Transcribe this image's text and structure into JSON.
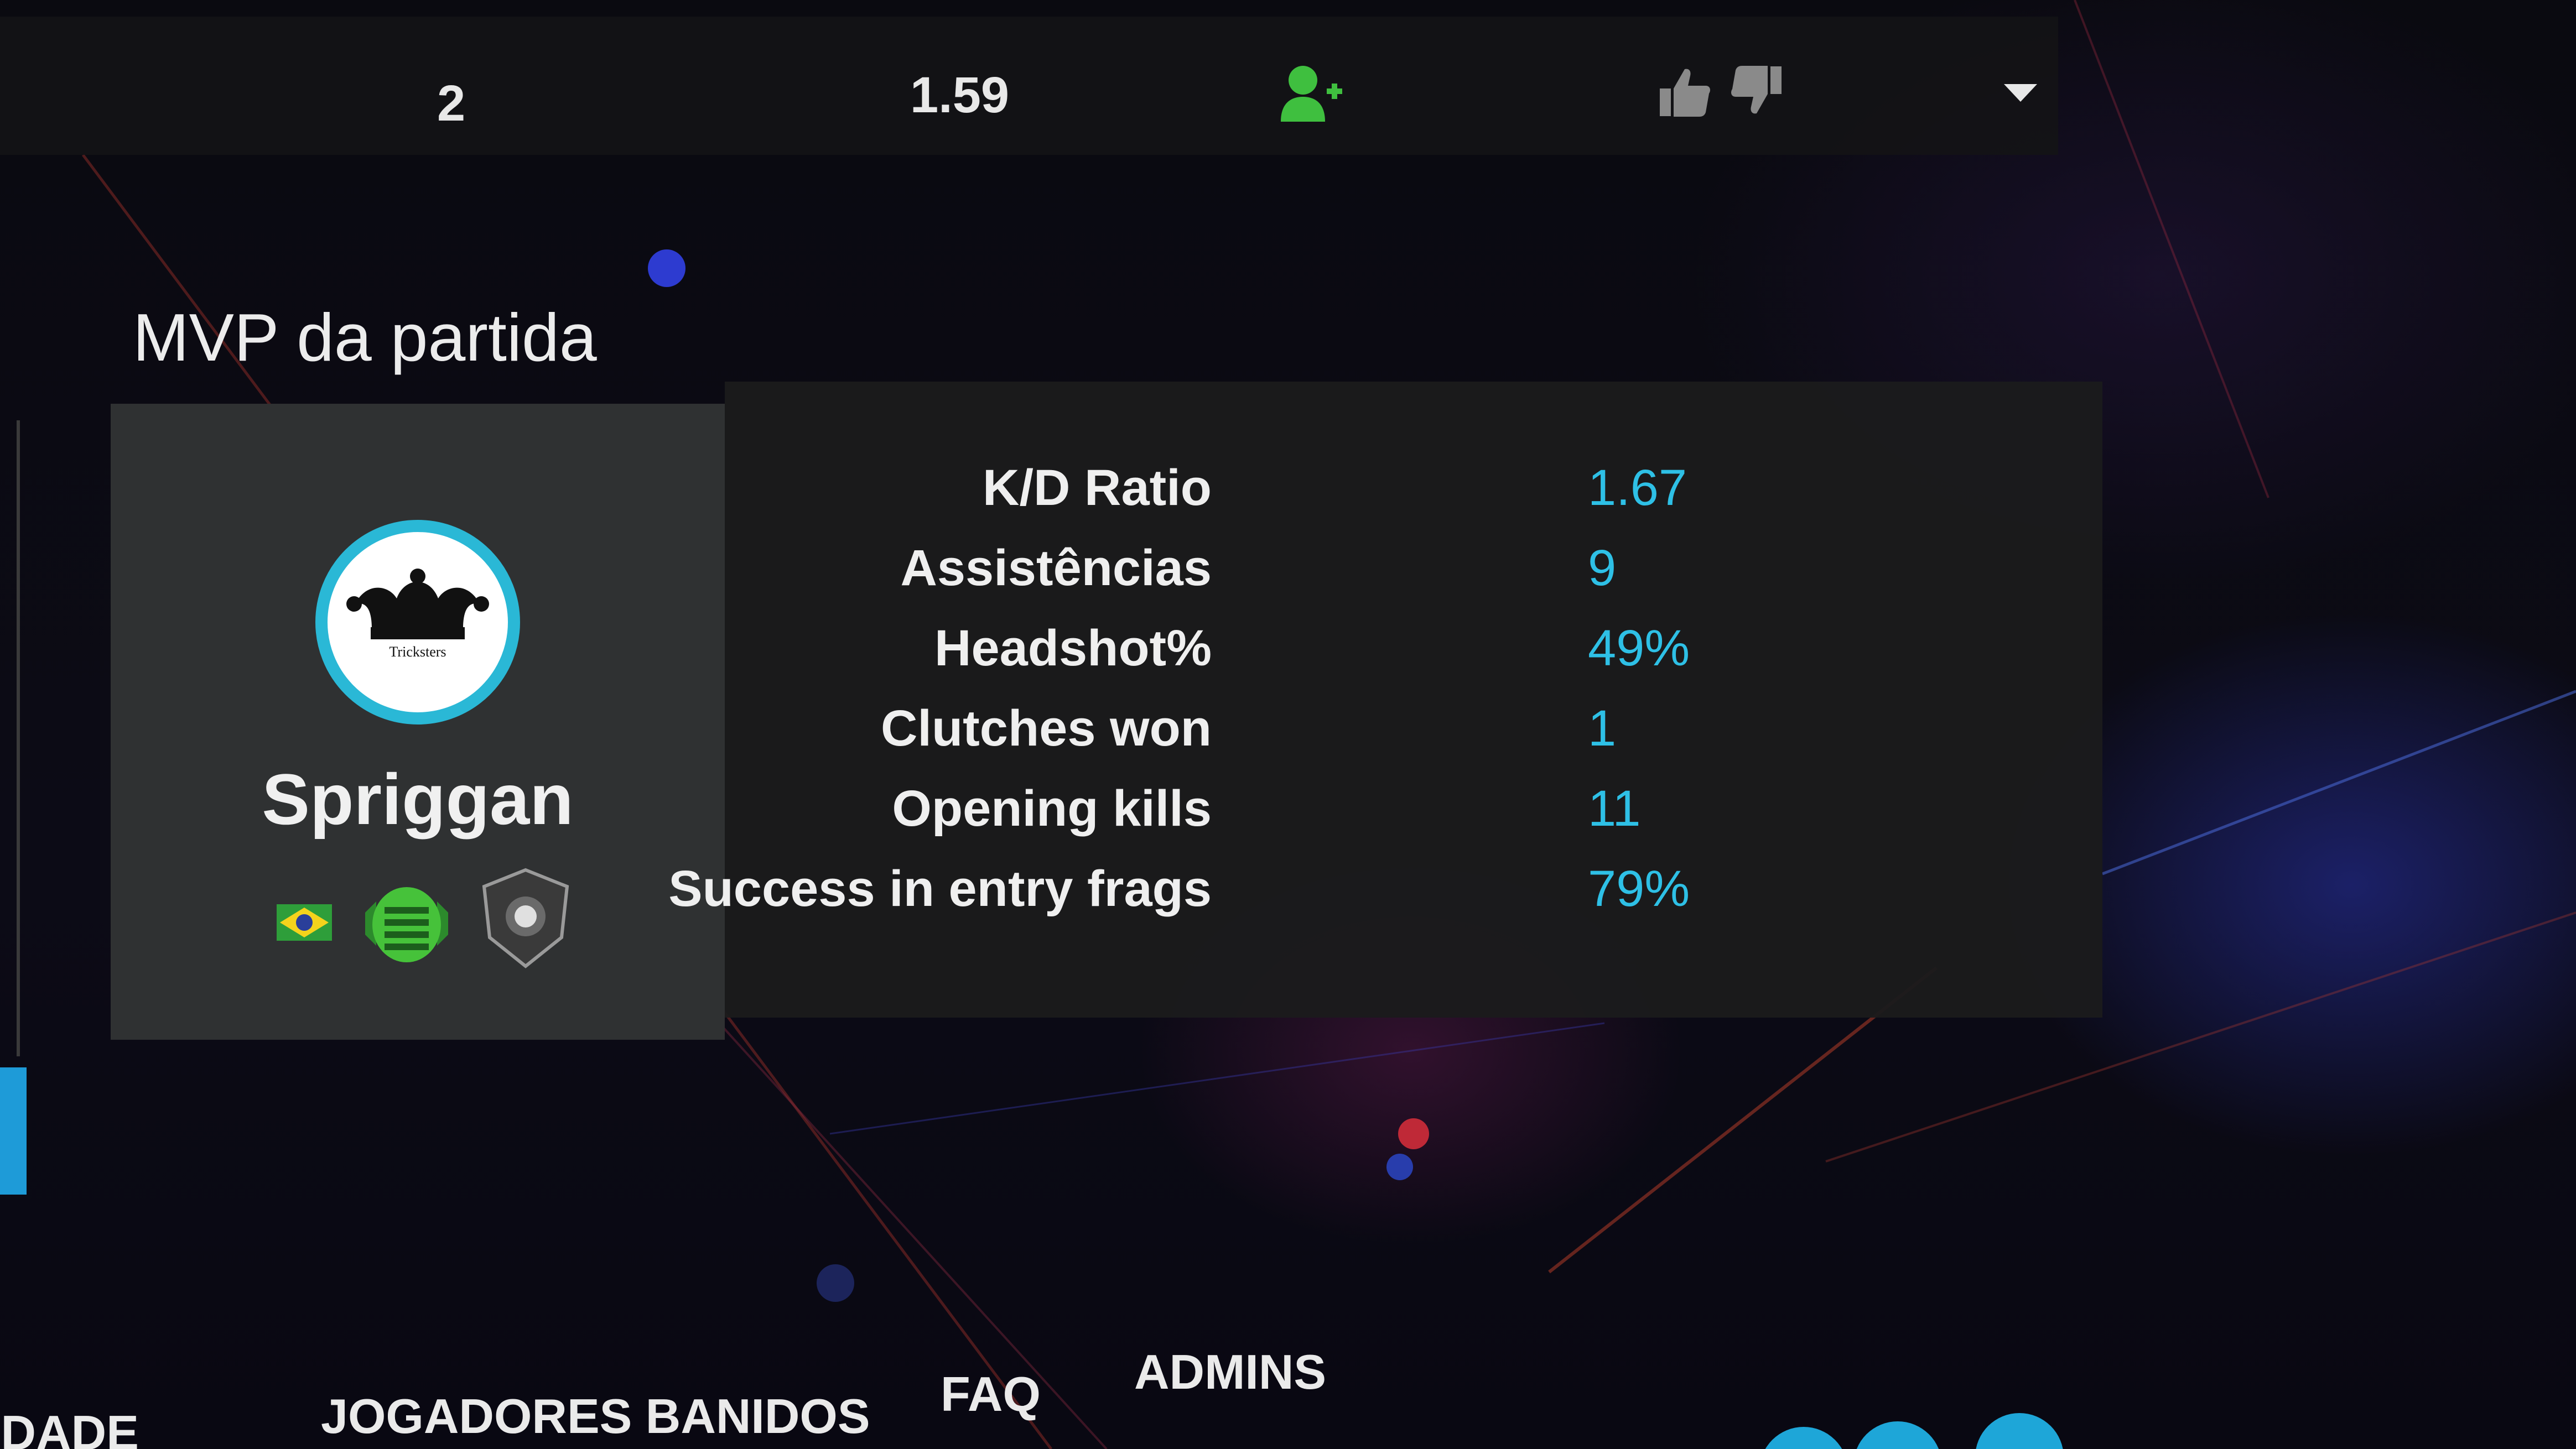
{
  "top_row": {
    "value_1": "2",
    "value_2": "1.59",
    "icons": [
      "add-friend-icon",
      "thumbs-up-icon",
      "thumbs-down-icon",
      "dropdown-icon"
    ]
  },
  "mvp": {
    "title": "MVP da partida",
    "player_name": "Spriggan",
    "avatar_text": "Tricksters",
    "stats": [
      {
        "label": "K/D Ratio",
        "value": "1.67"
      },
      {
        "label": "Assistências",
        "value": "9"
      },
      {
        "label": "Headshot%",
        "value": "49%"
      },
      {
        "label": "Clutches won",
        "value": "1"
      },
      {
        "label": "Opening kills",
        "value": "11"
      },
      {
        "label": "Success in entry frags",
        "value": "79%"
      }
    ]
  },
  "bottom_nav": {
    "items": [
      "ACIDADE",
      "JOGADORES BANIDOS",
      "FAQ",
      "ADMINS"
    ]
  },
  "colors": {
    "accent": "#2ec0e6",
    "avatar_ring": "#2ab8d6",
    "friend_icon": "#3fbf3f",
    "panel_bg": "#2f3132",
    "stats_bg": "#1b1b1c"
  }
}
